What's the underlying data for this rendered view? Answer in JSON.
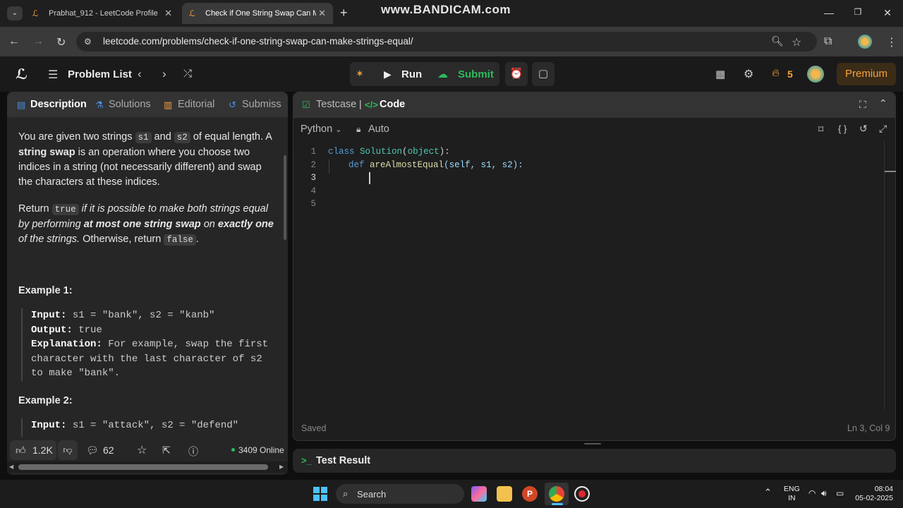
{
  "browser": {
    "tabs": [
      {
        "label": "Prabhat_912 - LeetCode Profile"
      },
      {
        "label": "Check if One String Swap Can Ma"
      }
    ],
    "watermark": "www.BANDICAM.com",
    "url": "leetcode.com/problems/check-if-one-string-swap-can-make-strings-equal/"
  },
  "nav": {
    "problem_list": "Problem List",
    "run": "Run",
    "submit": "Submit",
    "streak": "5",
    "premium": "Premium"
  },
  "left": {
    "tabs": [
      "Description",
      "Solutions",
      "Editorial",
      "Submiss"
    ],
    "desc": {
      "p1a": "You are given two strings ",
      "s1": "s1",
      "p1b": " and ",
      "s2": "s2",
      "p1c": " of equal length. A ",
      "p1bold": "string swap",
      "p1d": " is an operation where you choose two indices in a string (not necessarily different) and swap the characters at these indices.",
      "p2a": "Return ",
      "true": "true",
      "p2b": " if it is possible to make both strings equal by performing ",
      "p2bold1": "at most one string swap",
      "p2c": " on ",
      "p2bold2": "exactly one",
      "p2d": " of the strings.",
      "p2e": " Otherwise, return ",
      "false": "false",
      "p2f": "."
    },
    "example1": {
      "heading": "Example 1:",
      "input_label": "Input:",
      "input": " s1 = \"bank\", s2 = \"kanb\"",
      "output_label": "Output:",
      "output": " true",
      "expl_label": "Explanation:",
      "expl": " For example, swap the first character with the last character of s2 to make \"bank\"."
    },
    "example2": {
      "heading": "Example 2:",
      "input_label": "Input:",
      "input": " s1 = \"attack\", s2 = \"defend\""
    },
    "footer": {
      "likes": "1.2K",
      "comments": "62",
      "online": "3409 Online"
    }
  },
  "right": {
    "tab_testcase": "Testcase",
    "tab_code": "Code",
    "language": "Python",
    "auto": "Auto",
    "line_numbers": [
      "1",
      "2",
      "3",
      "4",
      "5"
    ],
    "code": {
      "l1_kw": "class",
      "l1_cls": "Solution",
      "l1_open": "(",
      "l1_base": "object",
      "l1_close": "):",
      "l2_kw": "def",
      "l2_fn": "areAlmostEqual",
      "l2_args": "(self, s1, s2):"
    },
    "status_saved": "Saved",
    "cursor_pos": "Ln 3, Col 9",
    "test_result": "Test Result"
  },
  "taskbar": {
    "search": "Search",
    "lang_top": "ENG",
    "lang_bottom": "IN",
    "time": "08:04",
    "date": "05-02-2025"
  },
  "colors": {
    "accent_green": "#2cbb5d",
    "premium_orange": "#f7a23c",
    "page_bg": "#1a1a1a"
  }
}
